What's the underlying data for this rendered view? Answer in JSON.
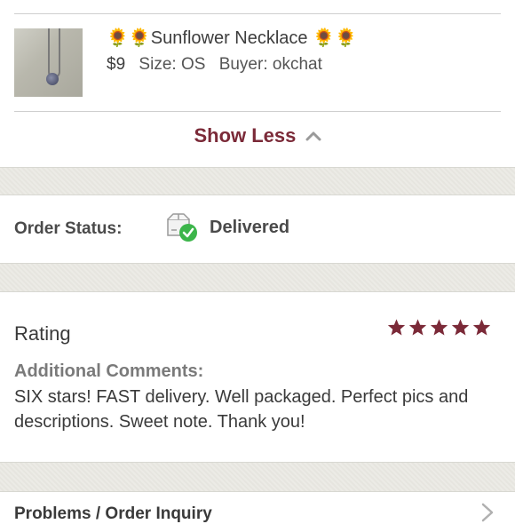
{
  "item": {
    "title": "🌻🌻Sunflower Necklace 🌻🌻",
    "price": "$9",
    "size": "Size: OS",
    "buyer": "Buyer: okchat"
  },
  "show_less_label": "Show Less",
  "order_status": {
    "label": "Order Status:",
    "value": "Delivered"
  },
  "rating": {
    "label": "Rating",
    "stars": 5,
    "max": 5,
    "star_color": "#7b2a38"
  },
  "comments": {
    "label": "Additional Comments:",
    "text": "SIX stars! FAST delivery. Well packaged. Perfect pics and descriptions. Sweet note. Thank you!"
  },
  "problems_label": "Problems / Order Inquiry",
  "colors": {
    "accent": "#7b2a38",
    "delivered_check": "#3cb54a"
  }
}
